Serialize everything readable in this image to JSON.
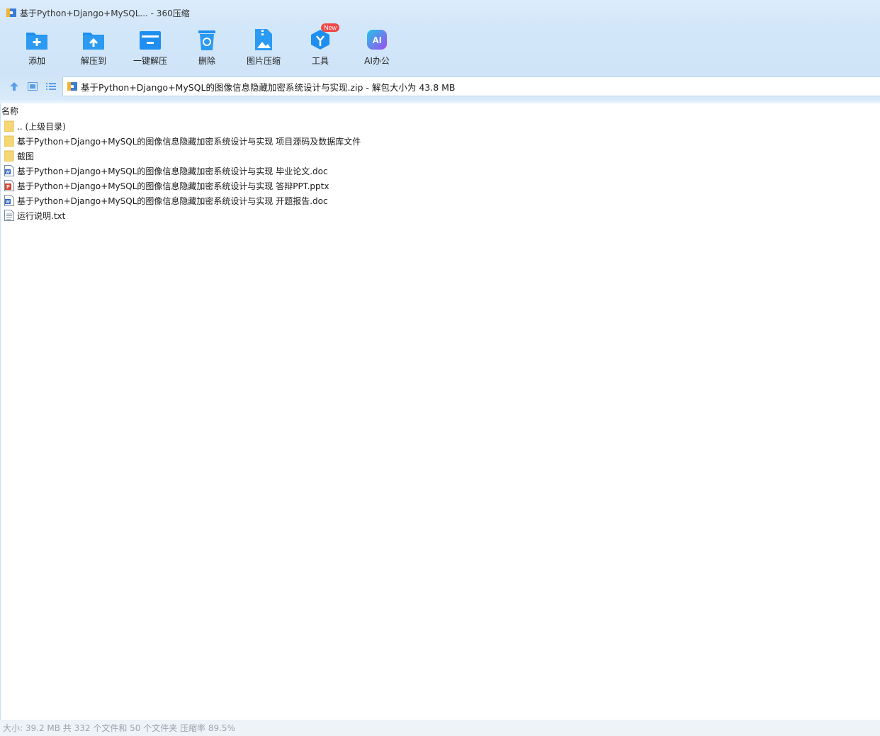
{
  "window": {
    "title": "基于Python+Django+MySQL... - 360压缩"
  },
  "toolbar": {
    "items": [
      {
        "label": "添加",
        "icon": "add-icon"
      },
      {
        "label": "解压到",
        "icon": "extract-to-icon"
      },
      {
        "label": "一键解压",
        "icon": "one-click-extract-icon"
      },
      {
        "label": "删除",
        "icon": "delete-icon"
      },
      {
        "label": "图片压缩",
        "icon": "image-compress-icon"
      },
      {
        "label": "工具",
        "icon": "tools-icon",
        "badge": "New"
      },
      {
        "label": "AI办公",
        "icon": "ai-office-icon",
        "glyph": "AI"
      }
    ]
  },
  "nav": {
    "path": "基于Python+Django+MySQL的图像信息隐藏加密系统设计与实现.zip - 解包大小为 43.8 MB"
  },
  "list": {
    "column_name": "名称",
    "files": [
      {
        "name": ".. (上级目录)",
        "type": "folder"
      },
      {
        "name": "基于Python+Django+MySQL的图像信息隐藏加密系统设计与实现 项目源码及数据库文件",
        "type": "folder"
      },
      {
        "name": "截图",
        "type": "folder"
      },
      {
        "name": "基于Python+Django+MySQL的图像信息隐藏加密系统设计与实现 毕业论文.doc",
        "type": "doc"
      },
      {
        "name": "基于Python+Django+MySQL的图像信息隐藏加密系统设计与实现 答辩PPT.pptx",
        "type": "ppt"
      },
      {
        "name": "基于Python+Django+MySQL的图像信息隐藏加密系统设计与实现 开题报告.doc",
        "type": "doc"
      },
      {
        "name": "运行说明.txt",
        "type": "txt"
      }
    ]
  },
  "status": {
    "text": "大小: 39.2 MB 共 332 个文件和 50 个文件夹 压缩率 89.5%"
  },
  "colors": {
    "accent": "#1e8ff0",
    "toolbar_bg": "#d3e7fa",
    "folder": "#f7d774",
    "ppt": "#d9432f",
    "badge": "#f04848"
  }
}
